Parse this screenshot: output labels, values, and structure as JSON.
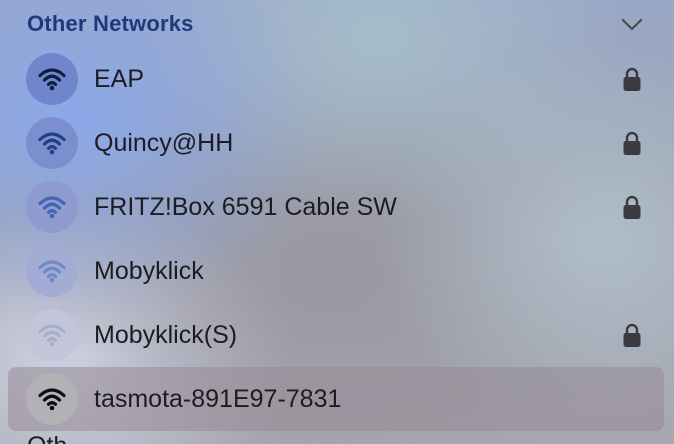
{
  "section": {
    "title": "Other Networks",
    "chevron_icon": "chevron-down-icon"
  },
  "networks": [
    {
      "name": "EAP",
      "locked": true,
      "signal_bars": 3,
      "icon_color": "#0f1c3a",
      "circle_color": "#6f86cc",
      "selected": false
    },
    {
      "name": "Quincy@HH",
      "locked": true,
      "signal_bars": 3,
      "icon_color": "#1f3f86",
      "circle_color": "#7b8fcf",
      "selected": false
    },
    {
      "name": "FRITZ!Box 6591 Cable SW",
      "locked": true,
      "signal_bars": 3,
      "icon_color": "#4465b5",
      "circle_color": "#8d9bcf",
      "selected": false
    },
    {
      "name": "Mobyklick",
      "locked": false,
      "signal_bars": 2,
      "icon_color": "#7289c8",
      "circle_color": "#a2acd4",
      "selected": false
    },
    {
      "name": "Mobyklick(S)",
      "locked": true,
      "signal_bars": 1,
      "icon_color": "#a7afca",
      "circle_color": "#c2c6d8",
      "selected": false
    },
    {
      "name": "tasmota-891E97-7831",
      "locked": false,
      "signal_bars": 3,
      "icon_color": "#0d0d10",
      "circle_color": "#b3b1b6",
      "selected": true
    }
  ],
  "next_section_peek": "Oth",
  "colors": {
    "section_title": "#1f3a7a",
    "lock": "#3a3a40",
    "selected_row": "#968a94"
  }
}
